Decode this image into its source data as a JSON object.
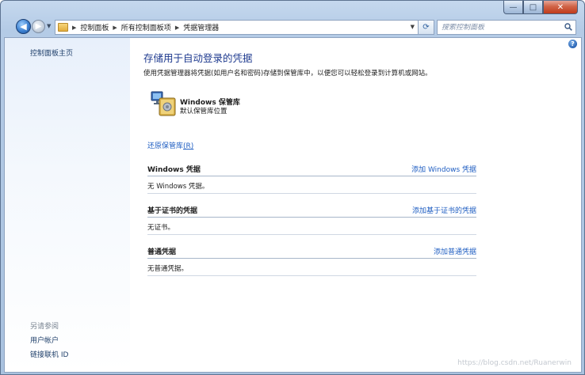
{
  "window": {
    "minimize_glyph": "—",
    "maximize_glyph": "□",
    "close_glyph": "✕"
  },
  "navigation": {
    "back_glyph": "◀",
    "forward_glyph": "▶",
    "breadcrumbs": [
      "控制面板",
      "所有控制面板项",
      "凭据管理器"
    ],
    "search_placeholder": "搜索控制面板"
  },
  "sidebar": {
    "home_link": "控制面板主页",
    "see_also_heading": "另请参阅",
    "links": [
      "用户帐户",
      "链接联机 ID"
    ]
  },
  "main": {
    "title": "存储用于自动登录的凭据",
    "description": "使用凭据管理器将凭据(如用户名和密码)存储到保管库中，以便您可以轻松登录到计算机或网站。",
    "vault": {
      "title": "Windows 保管库",
      "subtitle": "默认保管库位置"
    },
    "restore_link": "还原保管库",
    "restore_shortcut": "(R)",
    "sections": [
      {
        "title": "Windows 凭据",
        "add_label": "添加 Windows 凭据",
        "empty_text": "无 Windows 凭据。"
      },
      {
        "title": "基于证书的凭据",
        "add_label": "添加基于证书的凭据",
        "empty_text": "无证书。"
      },
      {
        "title": "普通凭据",
        "add_label": "添加普通凭据",
        "empty_text": "无普通凭据。"
      }
    ]
  },
  "watermark": "https://blog.csdn.net/Ruanerwin",
  "colors": {
    "link": "#1f5ec2",
    "title": "#1e3a8f",
    "sidebar_link": "#1f3f6a"
  }
}
